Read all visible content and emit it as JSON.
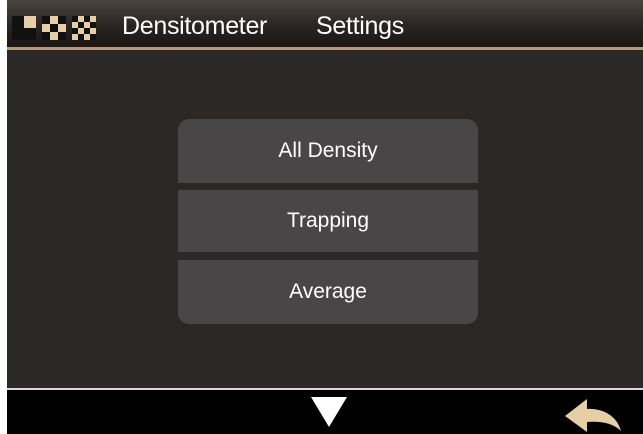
{
  "titlebar": {
    "app_title": "Densitometer",
    "section_title": "Settings",
    "icons": [
      "solid-patch-icon",
      "halftone-patch-icon",
      "checker-patch-icon"
    ]
  },
  "menu": {
    "items": [
      {
        "label": "All Density"
      },
      {
        "label": "Trapping"
      },
      {
        "label": "Average"
      }
    ]
  },
  "bottombar": {
    "icons": [
      "down-arrow-icon",
      "back-arrow-icon"
    ]
  },
  "colors": {
    "accent": "#b39b7b",
    "button_bg": "#484646",
    "panel_bg": "#2b2827",
    "icon_light": "#e6cfa6"
  }
}
